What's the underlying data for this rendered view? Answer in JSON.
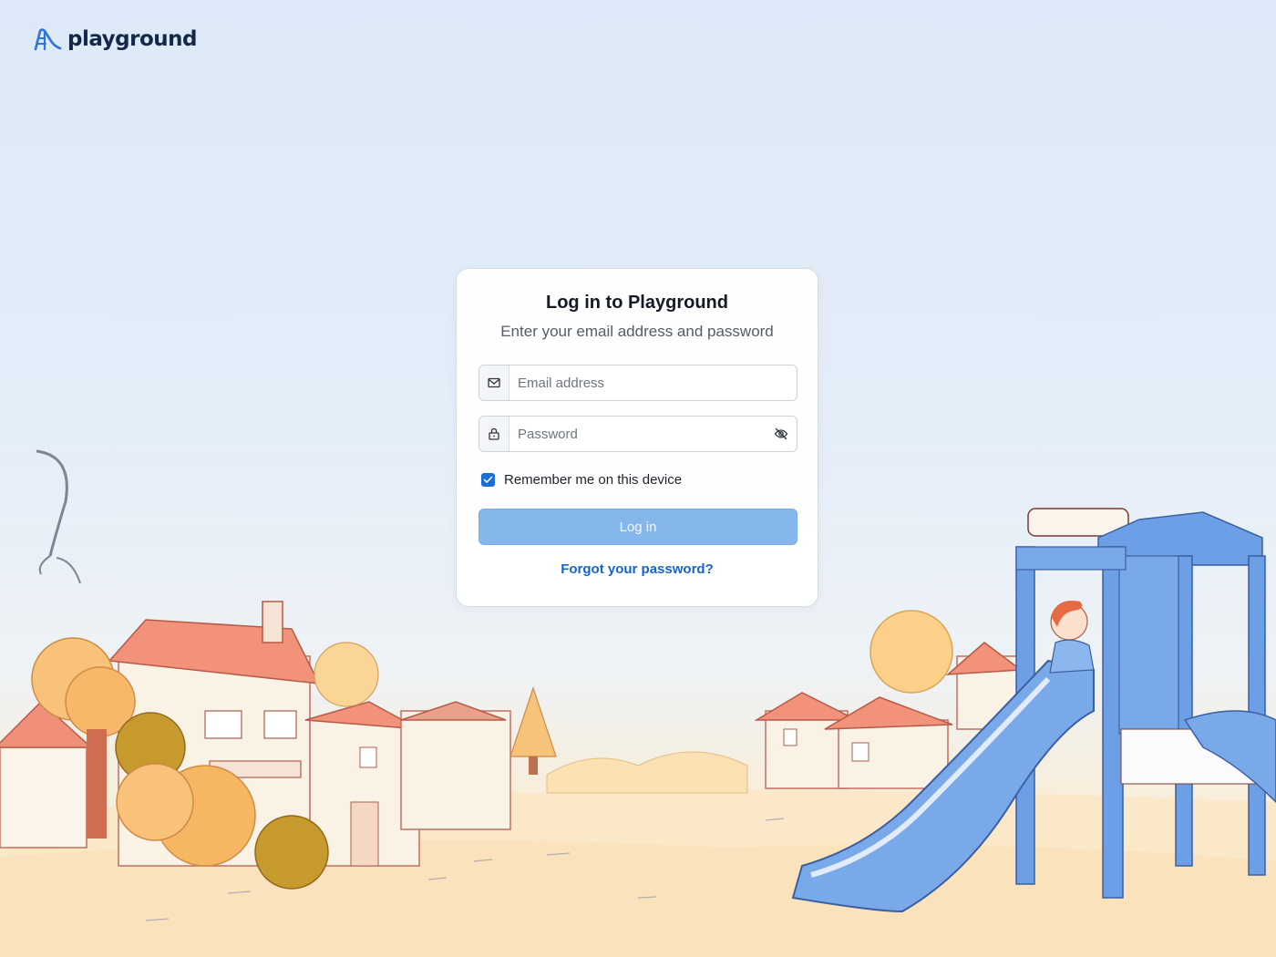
{
  "brand": {
    "name": "playground",
    "logo_icon": "slide-logo-icon",
    "color": "#16284a",
    "accent": "#2f74d9"
  },
  "login": {
    "title": "Log in to Playground",
    "subtitle": "Enter your email address and password",
    "email": {
      "placeholder": "Email address",
      "value": "",
      "icon": "mail-icon"
    },
    "password": {
      "placeholder": "Password",
      "value": "",
      "icon": "lock-icon",
      "toggle_icon": "eye-off-icon"
    },
    "remember": {
      "label": "Remember me on this device",
      "checked": true
    },
    "submit_label": "Log in",
    "forgot_label": "Forgot your password?"
  },
  "colors": {
    "primary": "#1a6fd6",
    "button_disabled": "#85b7ec",
    "link": "#1565c8"
  }
}
